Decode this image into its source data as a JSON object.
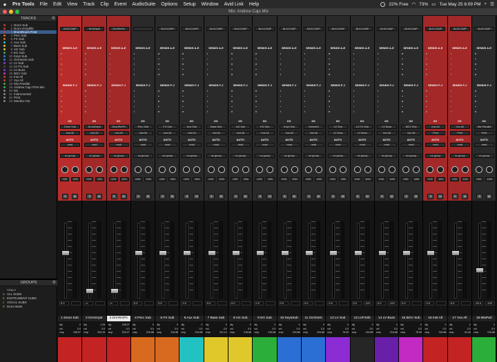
{
  "menubar": {
    "app": "Pro Tools",
    "menus": [
      "File",
      "Edit",
      "View",
      "Track",
      "Clip",
      "Event",
      "AudioSuite",
      "Options",
      "Setup",
      "Window",
      "Avid Link",
      "Help"
    ],
    "status_free": "22% Free",
    "battery": "73%",
    "datetime": "Tue May 25  6:09 PM"
  },
  "window": {
    "title": "Mix: Andrew Cajo Mix"
  },
  "tracks_panel": {
    "title": "TRACKS",
    "items": [
      {
        "num": "1",
        "name": "Drum Sub",
        "color": "#c23b3b"
      },
      {
        "num": "2",
        "name": "Drum Dcrptfiltr",
        "color": "#c23b3b"
      },
      {
        "num": "3",
        "name": "DrumRoom Post",
        "color": "#c23b3b",
        "selected": true
      },
      {
        "num": "4",
        "name": "Perc Sub",
        "color": "#d86a2a"
      },
      {
        "num": "5",
        "name": "FX Sub",
        "color": "#d86a2a"
      },
      {
        "num": "6",
        "name": "Aux Sub",
        "color": "#2ec4c4"
      },
      {
        "num": "7",
        "name": "Bass Sub",
        "color": "#e0c93a"
      },
      {
        "num": "8",
        "name": "AG Sub",
        "color": "#e0c93a"
      },
      {
        "num": "9",
        "name": "EG Sub",
        "color": "#3ab04a"
      },
      {
        "num": "10",
        "name": "Keys Sub",
        "color": "#3a7ad8"
      },
      {
        "num": "11",
        "name": "Orchestra Sub",
        "color": "#3a7ad8"
      },
      {
        "num": "12",
        "name": "LV Sub",
        "color": "#8a3ad8"
      },
      {
        "num": "13",
        "name": "LV FX Sub",
        "color": "#444444"
      },
      {
        "num": "14",
        "name": "LV Buss",
        "color": "#8a3ad8"
      },
      {
        "num": "15",
        "name": "BGV Sub",
        "color": "#c43ac4"
      },
      {
        "num": "16",
        "name": "Inst All",
        "color": "#c23b3b"
      },
      {
        "num": "17",
        "name": "Vox All",
        "color": "#c23b3b"
      },
      {
        "num": "18",
        "name": "Mix Parallel",
        "color": "#3ab04a"
      },
      {
        "num": "19",
        "name": "Andrew Cajo Print Mix",
        "color": "#3ab04a"
      },
      {
        "num": "20",
        "name": "M1",
        "color": "#888888"
      },
      {
        "num": "21",
        "name": "Instrumental",
        "color": "#888888"
      },
      {
        "num": "22",
        "name": "Print",
        "color": "#888888"
      },
      {
        "num": "23",
        "name": "Mumbo Out",
        "color": "#888888"
      }
    ]
  },
  "groups_panel": {
    "title": "GROUPS",
    "items": [
      {
        "letter": "",
        "name": "<ALL>"
      },
      {
        "letter": "a",
        "name": "ALL SUBS"
      },
      {
        "letter": "b",
        "name": "INSTRUMENT SUBS"
      },
      {
        "letter": "c",
        "name": "VOCAL SUBS"
      },
      {
        "letter": "d",
        "name": "Drum Bank"
      }
    ]
  },
  "strip_labels": {
    "sends_ae": "SENDS A-E",
    "sends_fj": "SENDS F-J",
    "io": "I/O",
    "auto": "AUTO",
    "group": "no group",
    "pan_left": "‹100",
    "pan_right": "100›",
    "solo": "S",
    "mute": "M",
    "dly": "dly",
    "vol_label": "vol",
    "cmp_label": "cmp"
  },
  "strips": [
    {
      "name": "1 Drum Sub",
      "color": "#b92c2c",
      "bar": "#c42323",
      "input": "Drum Sub",
      "output": "Inst All",
      "auto": "read",
      "vol": "0.0",
      "peak": "",
      "dly": "0",
      "v": "0.0",
      "cmp": "108.07",
      "insert": "BLKCOMP",
      "fader": 0.6
    },
    {
      "name": "2 DrmDcptr",
      "color": "#a32828",
      "bar": "#c42323",
      "input": "DrumDcptr",
      "output": "Inst All",
      "auto": "read",
      "vol": "-∞",
      "peak": "",
      "dly": "1.29",
      "v": "0.0",
      "cmp": "303.25",
      "insert": "DrmDcptr",
      "fader": 0.05
    },
    {
      "name": "3 DrmRmPs",
      "color": "#a32828",
      "bar": "#c42323",
      "input": "DrumRmPs",
      "output": "Inst All",
      "auto": "read",
      "vol": "-∞",
      "peak": "",
      "dly": "108.07",
      "v": "0.0",
      "cmp": "203.27",
      "insert": "DrmRmPs",
      "fader": 0.05
    },
    {
      "name": "4 Perc Sub",
      "color": "#2a2a2a",
      "bar": "#d86a1f",
      "input": "Perc Sub",
      "output": "Inst All",
      "auto": "read",
      "vol": "0.0",
      "peak": "",
      "dly": "0",
      "v": "0.0",
      "cmp": "216.88",
      "insert": "",
      "fader": 0.6
    },
    {
      "name": "5 FX Sub",
      "color": "#2a2a2a",
      "bar": "#d86a1f",
      "input": "FX Sub",
      "output": "Inst All",
      "auto": "read",
      "vol": "0.0",
      "peak": "",
      "dly": "0",
      "v": "0.0",
      "cmp": "216.88",
      "insert": "BLKCOMP",
      "fader": 0.6
    },
    {
      "name": "6 Aux Sub",
      "color": "#2a2a2a",
      "bar": "#23c2c2",
      "input": "Aux Sub",
      "output": "Inst All",
      "auto": "read",
      "vol": "0.0",
      "peak": "",
      "dly": "0",
      "v": "0.0",
      "cmp": "216.88",
      "insert": "BLKCOMP",
      "fader": 0.6
    },
    {
      "name": "7 Bass Sub",
      "color": "#2a2a2a",
      "bar": "#e1c82a",
      "input": "Bass Sub",
      "output": "Inst All",
      "auto": "read",
      "vol": "0.0",
      "peak": "",
      "dly": "0",
      "v": "0.0",
      "cmp": "112.12",
      "insert": "BLKCOMP",
      "fader": 0.6
    },
    {
      "name": "8 AG Sub",
      "color": "#2a2a2a",
      "bar": "#e1c82a",
      "input": "AG Sub",
      "output": "Inst All",
      "auto": "read",
      "vol": "0.0",
      "peak": "",
      "dly": "0",
      "v": "0.0",
      "cmp": "216.88",
      "insert": "BLKCOMP",
      "fader": 0.6
    },
    {
      "name": "9 EG Sub",
      "color": "#2a2a2a",
      "bar": "#2cae3a",
      "input": "EG Sub",
      "output": "Inst All",
      "auto": "read",
      "vol": "0.0",
      "peak": "",
      "dly": "0",
      "v": "0.0",
      "cmp": "216.88",
      "insert": "BLKCOMP",
      "fader": 0.6
    },
    {
      "name": "10 KeysSub",
      "color": "#2a2a2a",
      "bar": "#2c6fd4",
      "input": "Keys Sub",
      "output": "Inst All",
      "auto": "read",
      "vol": "0.0",
      "peak": "",
      "dly": "0",
      "v": "0.0",
      "cmp": "216.88",
      "insert": "BLKCOMP",
      "fader": 0.6
    },
    {
      "name": "11 OrchstrS",
      "color": "#2a2a2a",
      "bar": "#2c6fd4",
      "input": "OrchstrS",
      "output": "Inst All",
      "auto": "read",
      "vol": "0.0",
      "peak": "",
      "dly": "0",
      "v": "0.0",
      "cmp": "216.88",
      "insert": "BLKCOMP",
      "fader": 0.6
    },
    {
      "name": "12 LV Sub",
      "color": "#2a2a2a",
      "bar": "#8c2cd4",
      "input": "LV Sub",
      "output": "LV Buss",
      "auto": "read",
      "vol": "0.0",
      "peak": "",
      "dly": "0",
      "v": "0.0",
      "cmp": "76.00",
      "insert": "BLKCOMP",
      "fader": 0.6
    },
    {
      "name": "13 LVFXSb",
      "color": "#2a2a2a",
      "bar": "#262626",
      "input": "LV FX Sub",
      "output": "LV Buss",
      "auto": "read",
      "vol": "0.0",
      "peak": "-122",
      "dly": "0",
      "v": "0.0",
      "cmp": "216.88",
      "insert": "BLKCOMP",
      "fader": 0.6
    },
    {
      "name": "14 LV Buss",
      "color": "#2a2a2a",
      "bar": "#6a1fa8",
      "input": "LV Buss",
      "output": "Vox All",
      "auto": "read",
      "vol": "0.0",
      "peak": "-122",
      "dly": "0",
      "v": "0.0",
      "cmp": "216.88",
      "insert": "BLKCOMP",
      "fader": 0.6
    },
    {
      "name": "15 BGV Sub",
      "color": "#2a2a2a",
      "bar": "#c22ac2",
      "input": "BGV Sub",
      "output": "Vox All",
      "auto": "read",
      "vol": "0.0",
      "peak": "",
      "dly": "0",
      "v": "0.0",
      "cmp": "76.00",
      "insert": "BLKCOMP",
      "fader": 0.6
    },
    {
      "name": "16 Inst All",
      "color": "#a32828",
      "bar": "#c42323",
      "input": "Inst All",
      "output": "Print",
      "auto": "read",
      "vol": "0.0",
      "peak": "",
      "dly": "0",
      "v": "0.0",
      "cmp": "216.88",
      "insert": "BLKCOMP",
      "fader": 0.6
    },
    {
      "name": "17 Vox All",
      "color": "#a32828",
      "bar": "#c42323",
      "input": "Vox All",
      "output": "Print",
      "auto": "read",
      "vol": "0.0",
      "peak": "",
      "dly": "0",
      "v": "0.0",
      "cmp": "34.40",
      "insert": "BLKCOMP",
      "fader": 0.6
    },
    {
      "name": "18 MixParl",
      "color": "#2a2a2a",
      "bar": "#2cae3a",
      "input": "Mix Parallel",
      "output": "Print",
      "auto": "read",
      "vol": "-20.4",
      "peak": "-102",
      "dly": "0",
      "v": "0.0",
      "cmp": "216.88",
      "insert": "BLKCOMP",
      "fader": 0.35
    }
  ]
}
